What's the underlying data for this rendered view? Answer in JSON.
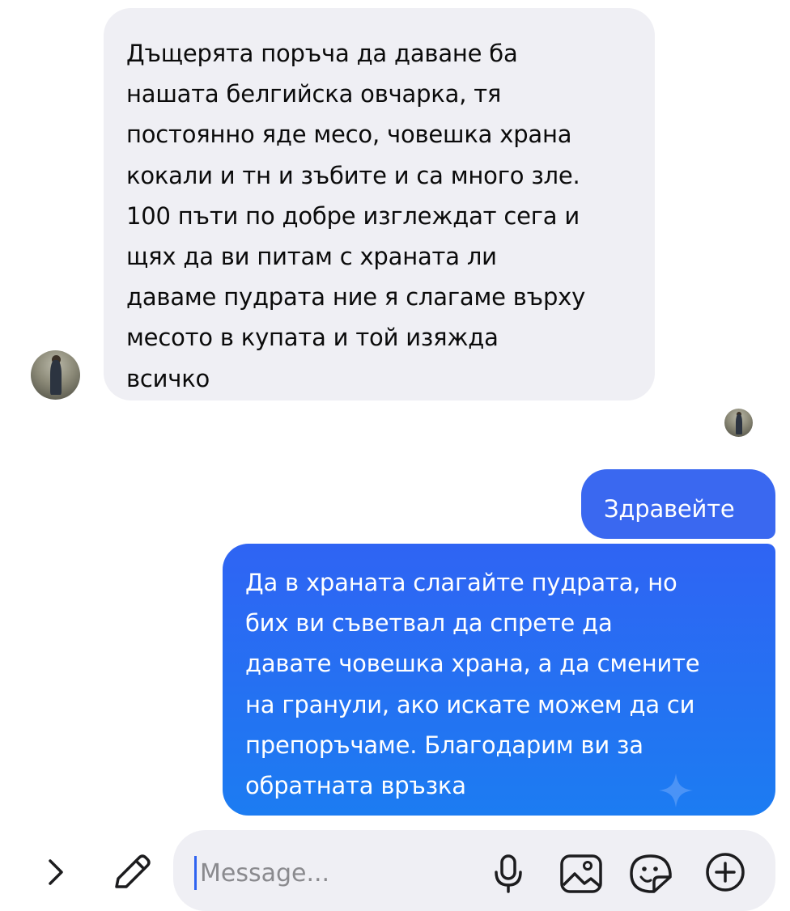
{
  "conversation": {
    "incoming": {
      "lines": [
        "Дъщерята поръча да даване ба",
        "нашата белгийска овчарка, тя",
        "постоянно яде месо, човешка храна",
        "кокали и тн и зъбите и са много зле.",
        "100 пъти по добре изглеждат сега и",
        "щях да ви питам с храната ли",
        "даваме пудрата ние я слагаме върху",
        "месото в купата и той изяжда",
        "всичко"
      ]
    },
    "outgoing_greeting": "Здравейте",
    "outgoing_reply": {
      "lines": [
        "Да в храната слагайте пудрата, но",
        "бих ви съветвал да спрете да",
        "давате човешка храна, а да смените",
        "на гранули, ако искате можем да си",
        "препоръчаме. Благодарим ви за",
        "обратната връзка"
      ]
    }
  },
  "composer": {
    "placeholder": "Message...",
    "icons": [
      "chevron-right-icon",
      "pencil-icon",
      "microphone-icon",
      "image-icon",
      "sticker-icon",
      "plus-circle-icon"
    ]
  },
  "colors": {
    "incoming_bubble": "#efeff4",
    "outgoing_bubble": "#3a68f0",
    "outgoing_gradient_end": "#1c7cf2",
    "icon_stroke": "#1c1c1e"
  }
}
